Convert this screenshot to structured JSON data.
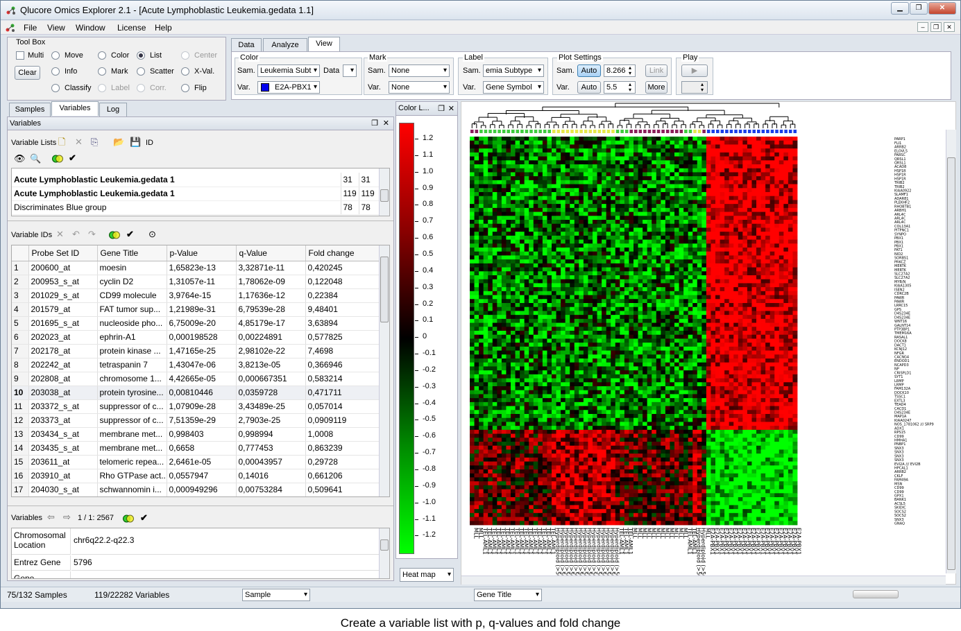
{
  "window": {
    "title": "Qlucore Omics Explorer 2.1 - [Acute Lymphoblastic Leukemia.gedata 1.1]"
  },
  "menu": [
    "File",
    "View",
    "Window",
    "License",
    "Help"
  ],
  "toolbox": {
    "title": "Tool Box",
    "multi": "Multi",
    "move": "Move",
    "color": "Color",
    "list": "List",
    "center": "Center",
    "clear": "Clear",
    "info": "Info",
    "mark": "Mark",
    "scatter": "Scatter",
    "xval": "X-Val.",
    "classify": "Classify",
    "label": "Label",
    "corr": "Corr.",
    "flip": "Flip"
  },
  "top_tabs": [
    "Data",
    "Analyze",
    "View"
  ],
  "view": {
    "color": {
      "title": "Color",
      "sam": "Sam.",
      "sam_value": "Leukemia Subt",
      "data": "Data",
      "var": "Var.",
      "var_value": "E2A-PBX1",
      "var_swatch": "#0000ee"
    },
    "mark": {
      "title": "Mark",
      "sam": "Sam.",
      "sam_value": "None",
      "var": "Var.",
      "var_value": "None"
    },
    "label": {
      "title": "Label",
      "sam": "Sam.",
      "sam_value": "emia Subtype",
      "var": "Var.",
      "var_value": "Gene Symbol"
    },
    "plot": {
      "title": "Plot Settings",
      "sam": "Sam.",
      "auto1": "Auto",
      "val1": "8.266",
      "var": "Var.",
      "auto2": "Auto",
      "val2": "5.5",
      "link": "Link",
      "more": "More"
    },
    "play": {
      "title": "Play"
    }
  },
  "left_tabs": [
    "Samples",
    "Variables",
    "Log"
  ],
  "variables_panel": {
    "title": "Variables",
    "lists_label": "Variable Lists",
    "id_label": "ID",
    "lists": [
      {
        "name": "Acute Lymphoblastic Leukemia.gedata 1",
        "a": "31",
        "b": "31",
        "bold": true
      },
      {
        "name": "Acute Lymphoblastic Leukemia.gedata 1",
        "a": "119",
        "b": "119",
        "bold": true
      },
      {
        "name": "Discriminates Blue group",
        "a": "78",
        "b": "78",
        "bold": false
      }
    ]
  },
  "variable_ids": {
    "title": "Variable IDs",
    "columns": [
      "Probe Set ID",
      "Gene Title",
      "p-Value",
      "q-Value",
      "Fold change"
    ],
    "rows": [
      [
        "1",
        "200600_at",
        "moesin",
        "1,65823e-13",
        "3,32871e-11",
        "0,420245"
      ],
      [
        "2",
        "200953_s_at",
        "cyclin D2",
        "1,31057e-11",
        "1,78062e-09",
        "0,122048"
      ],
      [
        "3",
        "201029_s_at",
        "CD99 molecule",
        "3,9764e-15",
        "1,17636e-12",
        "0,22384"
      ],
      [
        "4",
        "201579_at",
        "FAT tumor sup...",
        "1,21989e-31",
        "6,79539e-28",
        "9,48401"
      ],
      [
        "5",
        "201695_s_at",
        "nucleoside pho...",
        "6,75009e-20",
        "4,85179e-17",
        "3,63894"
      ],
      [
        "6",
        "202023_at",
        "ephrin-A1",
        "0,000198528",
        "0,00224891",
        "0,577825"
      ],
      [
        "7",
        "202178_at",
        "protein kinase ...",
        "1,47165e-25",
        "2,98102e-22",
        "7,4698"
      ],
      [
        "8",
        "202242_at",
        "tetraspanin 7",
        "1,43047e-06",
        "3,8213e-05",
        "0,366946"
      ],
      [
        "9",
        "202808_at",
        "chromosome 1...",
        "4,42665e-05",
        "0,000667351",
        "0,583214"
      ],
      [
        "10",
        "203038_at",
        "protein tyrosine...",
        "0,00810446",
        "0,0359728",
        "0,471711"
      ],
      [
        "11",
        "203372_s_at",
        "suppressor of c...",
        "1,07909e-28",
        "3,43489e-25",
        "0,057014"
      ],
      [
        "12",
        "203373_at",
        "suppressor of c...",
        "7,51359e-29",
        "2,7903e-25",
        "0,0909119"
      ],
      [
        "13",
        "203434_s_at",
        "membrane met...",
        "0,998403",
        "0,998994",
        "1,0008"
      ],
      [
        "14",
        "203435_s_at",
        "membrane met...",
        "0,6658",
        "0,777453",
        "0,863239"
      ],
      [
        "15",
        "203611_at",
        "telomeric repea...",
        "2,6461e-05",
        "0,00043957",
        "0,29728"
      ],
      [
        "16",
        "203910_at",
        "Rho GTPase act...",
        "0,0557947",
        "0,14016",
        "0,661206"
      ],
      [
        "17",
        "204030_s_at",
        "schwannomin i...",
        "0,000949296",
        "0,00753284",
        "0,509641"
      ]
    ]
  },
  "detail": {
    "title": "Variables",
    "nav": "1 / 1: 2567",
    "rows": [
      [
        "Chromosomal Location",
        "chr6q22.2-q22.3"
      ],
      [
        "Entrez Gene",
        "5796"
      ],
      [
        "Gene",
        ""
      ]
    ]
  },
  "color_legend": {
    "title": "Color L...",
    "ticks": [
      "1.2",
      "1.1",
      "1.0",
      "0.9",
      "0.8",
      "0.7",
      "0.6",
      "0.5",
      "0.4",
      "0.3",
      "0.2",
      "0.1",
      "0",
      "-0.1",
      "-0.2",
      "-0.3",
      "-0.4",
      "-0.5",
      "-0.6",
      "-0.7",
      "-0.8",
      "-0.9",
      "-1.0",
      "-1.1",
      "-1.2"
    ],
    "mode": "Heat map"
  },
  "heatmap": {
    "gene_labels": [
      "PARP1",
      "FLI1",
      "ARRB2",
      "ELOVL5",
      "FARSC",
      "QRSL1",
      "QRSL1",
      "ACAD8",
      "HSP1R",
      "HSP1R",
      "HSP1R",
      "TRIB2",
      "TRIB2",
      "KIAA0922",
      "SLAMF1",
      "ADAR81",
      "PLEKHF2",
      "RHOBTB1",
      "ARBH1",
      "ARL4C",
      "ARL4C",
      "ARL4C",
      "COL13A1",
      "PITPNC1",
      "SYNPO",
      "PBX1",
      "PBX1",
      "PBX1",
      "FAT1",
      "NID2",
      "SORBS1",
      "PRKCZ",
      "MERTK",
      "MERTK",
      "SLC27A2",
      "SLC27A2",
      "MYB/N",
      "KIAA1305",
      "ISEN2",
      "CDRC2B",
      "PAWR",
      "PAWR",
      "LRRC15",
      "GPS",
      "D4S234E",
      "D4S234E",
      "WNT16",
      "GALNT14",
      "PTP3BP1",
      "TMEM16A",
      "RASAL1",
      "DOCK8",
      "DACT1",
      "KCNJ12",
      "NFGR",
      "CACNG4",
      "ENDOD1",
      "NCAPD3",
      "NP",
      "CRISPLD1",
      "SYT1",
      "LRMP",
      "LRMP",
      "FAM132A",
      "DOCK10",
      "TSSC1",
      "EXTL3",
      "TEAD4",
      "CACD1",
      "D4S234E",
      "MAP1A",
      "KIAA0247",
      "NOS_1781062 /// SRP9",
      "ADX1",
      "RPS15",
      "CD99",
      "HMHA1",
      "PNBP1",
      "SNX3",
      "SNX3",
      "SNX3",
      "SNX3",
      "EVI2A /// EVI2B",
      "HPCAL1",
      "ARRB2",
      "CKLF",
      "FAM49A",
      "MSN",
      "CD99",
      "CD99",
      "GPX1",
      "BANK1",
      "ACSL5",
      "SKIDIC",
      "SOCS2",
      "SOCS2",
      "SNX3",
      "GNAQ"
    ],
    "sample_labels": [
      "MLL",
      "MLL",
      "TEL-AML1",
      "TEL-AML1",
      "TEL-AML1",
      "TEL-AML1",
      "TEL-AML1",
      "TEL-AML1",
      "TEL-AML1",
      "TEL-AML1",
      "TEL-AML1",
      "TEL-AML1",
      "TEL-AML1",
      "TEL-AML1",
      "TEL-AML1",
      "TEL-AML1",
      "TEL-AML1",
      "TEL-AML1",
      "Hyperdiploid (>50)",
      "Hyperdiploid (>50)",
      "Hyperdiploid (>50)",
      "Hyperdiploid (>50)",
      "Hyperdiploid (>50)",
      "Hyperdiploid (>50)",
      "Hyperdiploid (>50)",
      "Hyperdiploid (>50)",
      "Hyperdiploid (>50)",
      "Hyperdiploid (>50)",
      "Hyperdiploid (>50)",
      "Hyperdiploid (>50)",
      "Hyperdiploid (>50)",
      "Hyperdiploid (>50)",
      "TEL-AML1",
      "TEL-AML1",
      "TEL-AML1",
      "MLL",
      "MLL",
      "MLL",
      "MLL",
      "MLL",
      "MLL",
      "MLL",
      "MLL",
      "MLL",
      "MLL",
      "MLL",
      "MLL",
      "TEL-AML1",
      "TEL-AML1",
      "Hyperdiploid (>50)",
      "Hyperdiploid (>50)",
      "MLL",
      "E2A-PBX1",
      "E2A-PBX1",
      "E2A-PBX1",
      "E2A-PBX1",
      "E2A-PBX1",
      "E2A-PBX1",
      "E2A-PBX1",
      "E2A-PBX1",
      "E2A-PBX1",
      "E2A-PBX1",
      "E2A-PBX1",
      "E2A-PBX1",
      "E2A-PBX1",
      "E2A-PBX1",
      "E2A-PBX1",
      "E2A-PBX1",
      "E2A-PBX1",
      "E2A-PBX1",
      "E2A-PBX1",
      "E2A-PBX1"
    ],
    "group_colors": {
      "MLL": "#8b1f5a",
      "TEL-AML1": "#3ecc3e",
      "Hyperdiploid (>50)": "#e8e84a",
      "E2A-PBX1": "#1a3ee8"
    }
  },
  "status": {
    "samples": "75/132 Samples",
    "variables": "119/22282 Variables",
    "sample_combo": "Sample",
    "gene_combo": "Gene Title"
  },
  "caption": "Create a variable list with p, q-values and fold change"
}
